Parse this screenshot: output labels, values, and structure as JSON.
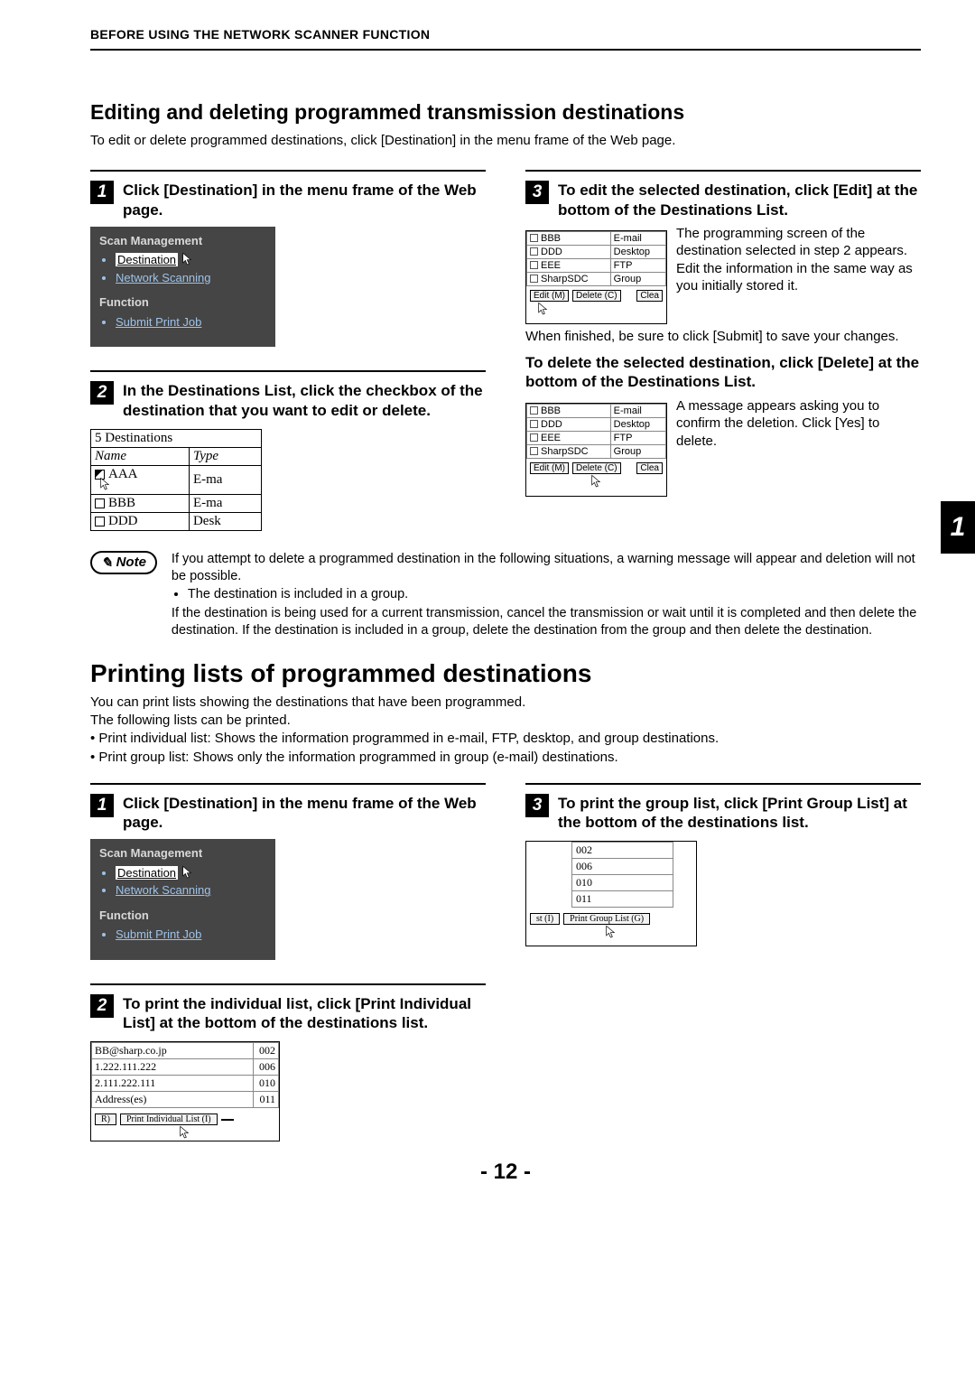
{
  "running_head": "BEFORE USING THE NETWORK SCANNER FUNCTION",
  "side_tab": "1",
  "sec1": {
    "title": "Editing and deleting programmed transmission destinations",
    "intro": "To edit or delete programmed destinations, click [Destination] in the menu frame of the Web page.",
    "step1": {
      "num": "1",
      "text": "Click [Destination] in the menu frame of the Web page."
    },
    "menu": {
      "scan_label": "Scan Management",
      "destination": "Destination",
      "network_scanning": "Network Scanning",
      "function_label": "Function",
      "submit_print_job": "Submit Print Job"
    },
    "step2": {
      "num": "2",
      "text": "In the Destinations List, click the checkbox of the destination that you want to edit or delete."
    },
    "dest_table": {
      "title": "5 Destinations",
      "name_col": "Name",
      "type_col": "Type",
      "rows": [
        {
          "name": "AAA",
          "type": "E-ma",
          "checked": true
        },
        {
          "name": "BBB",
          "type": "E-ma",
          "checked": false
        },
        {
          "name": "DDD",
          "type": "Desk",
          "checked": false
        }
      ]
    },
    "step3": {
      "num": "3",
      "text": "To edit the selected destination, click [Edit] at the bottom of the Destinations List."
    },
    "edit_rows": [
      {
        "name": "BBB",
        "type": "E-mail"
      },
      {
        "name": "DDD",
        "type": "Desktop"
      },
      {
        "name": "EEE",
        "type": "FTP"
      },
      {
        "name": "SharpSDC",
        "type": "Group"
      }
    ],
    "edit_btn": "Edit (M)",
    "delete_btn": "Delete (C)",
    "clear_btn": "Clea",
    "step3_para": "The programming screen of the destination selected in step 2 appears. Edit the information in the same way as you initially stored it.",
    "step3_below": "When finished, be sure to click [Submit] to save your changes.",
    "del_head": "To delete the selected destination, click [Delete] at the bottom of the Destinations List.",
    "del_para": "A message appears asking you to confirm the deletion. Click [Yes] to delete."
  },
  "note": {
    "label": "Note",
    "l1": "If you attempt to delete a programmed destination in the following situations, a warning message will appear and deletion will not be possible.",
    "bullet": "The destination is included in a group.",
    "l2": "If the destination is being used for a current transmission, cancel the transmission or wait until it is completed and then delete the destination. If the destination is included in a group, delete the destination from the group and then delete the destination."
  },
  "sec2": {
    "title": "Printing lists of programmed destinations",
    "l1": "You can print lists showing the destinations that have been programmed.",
    "l2": "The following lists can be printed.",
    "b1": "Print individual list: Shows the information programmed in e-mail, FTP, desktop, and group destinations.",
    "b2": "Print group list: Shows only the information programmed in group (e-mail) destinations.",
    "step1": {
      "num": "1",
      "text": "Click [Destination] in the menu frame of the Web page."
    },
    "step2": {
      "num": "2",
      "text": "To print the individual list, click [Print Individual List] at the bottom of the destinations list."
    },
    "ind_rows": [
      {
        "addr": "BB@sharp.co.jp",
        "no": "002"
      },
      {
        "addr": "1.222.111.222",
        "no": "006"
      },
      {
        "addr": "2.111.222.111",
        "no": "010"
      },
      {
        "addr": "Address(es)",
        "no": "011"
      }
    ],
    "ind_btn_r": "R)",
    "ind_btn": "Print Individual List (I)",
    "step3": {
      "num": "3",
      "text": "To print the group list, click [Print Group List] at the bottom of the destinations list."
    },
    "grp_rows": [
      "002",
      "006",
      "010",
      "011"
    ],
    "grp_btn_l": "st (I)",
    "grp_btn": "Print Group List (G)"
  },
  "page_number": "- 12 -"
}
